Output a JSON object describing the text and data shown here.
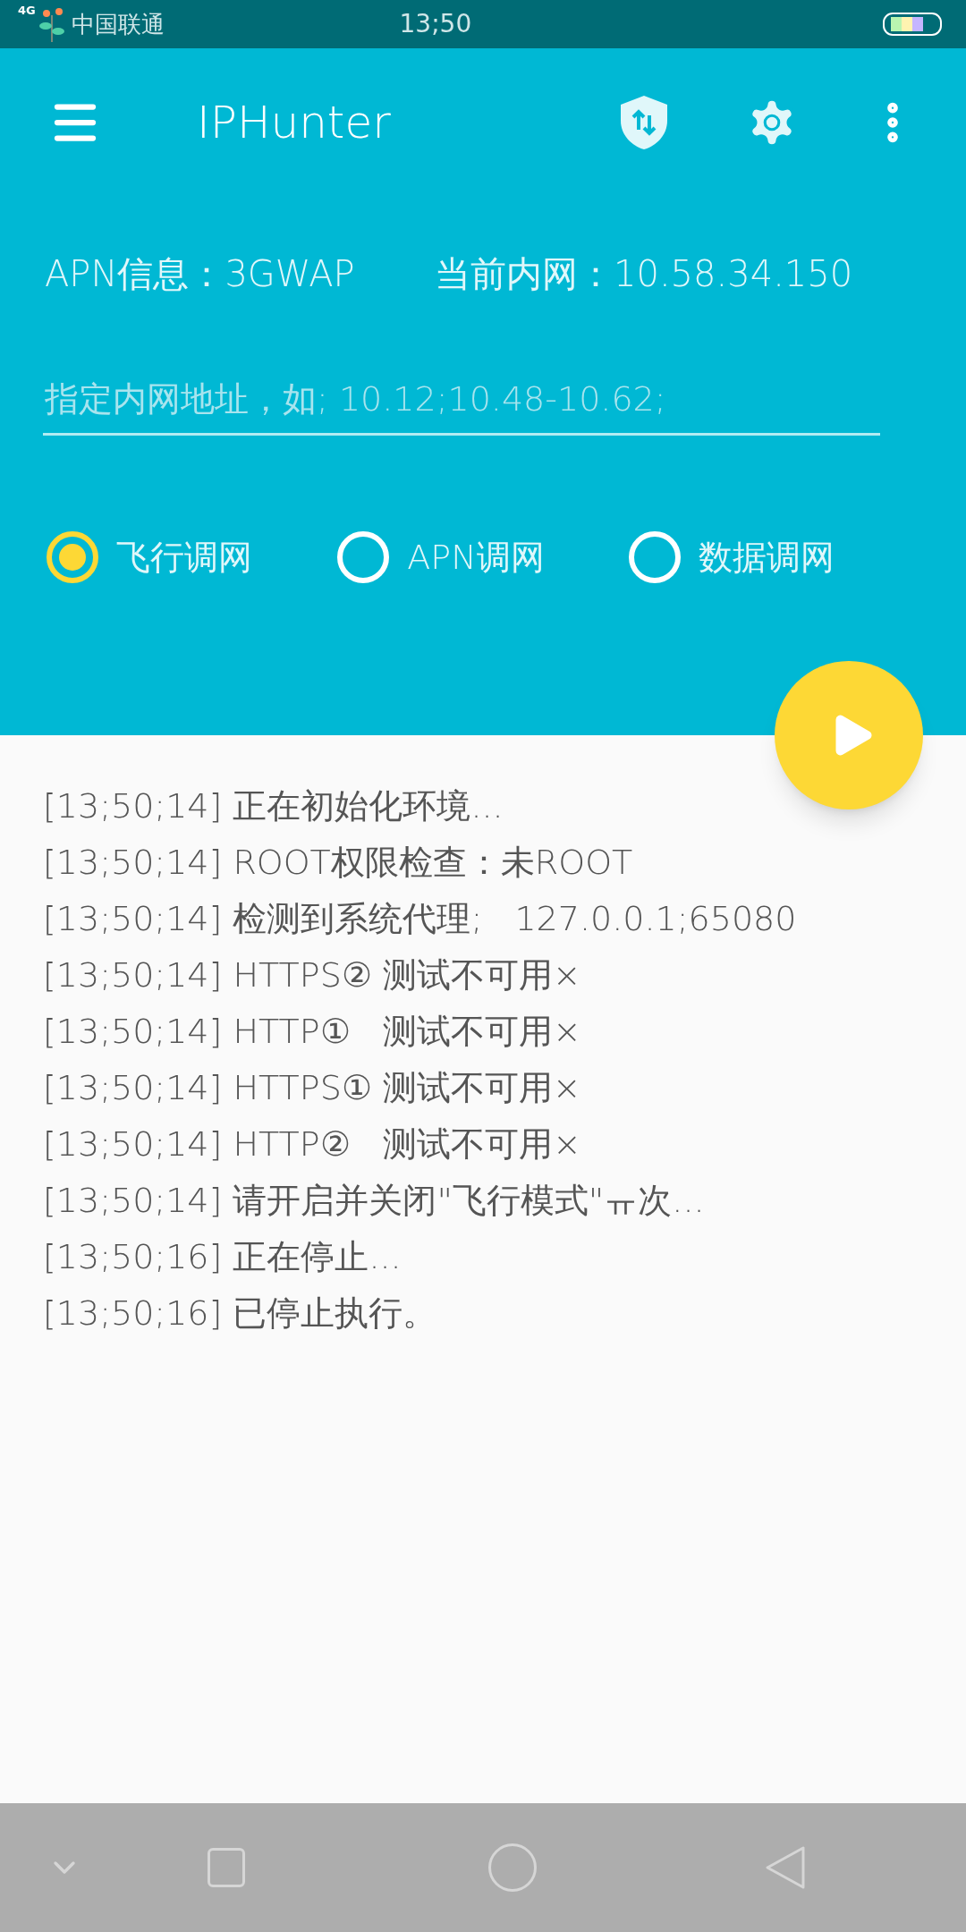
{
  "status_bar": {
    "network": "4G",
    "carrier": "中国联通",
    "time": "13;50"
  },
  "toolbar": {
    "title": "IPHunter"
  },
  "info": {
    "apn": "APN信息：3GWAP",
    "intranet": "当前内网：10.58.34.150"
  },
  "address_field": {
    "placeholder": "指定内网地址，如; 10.12;10.48-10.62;"
  },
  "modes": [
    {
      "label": "飞行调网",
      "selected": true
    },
    {
      "label": "APN调网",
      "selected": false
    },
    {
      "label": "数据调网",
      "selected": false
    }
  ],
  "log": [
    "[13;50;14] 正在初始化环境...",
    "[13;50;14] ROOT权限检查：未ROOT",
    "[13;50;14] 检测到系统代理;   127.0.0.1;65080",
    "[13;50;14] HTTPS② 测试不可用×",
    "[13;50;14] HTTP①   测试不可用×",
    "[13;50;14] HTTPS① 测试不可用×",
    "[13;50;14] HTTP②   测试不可用×",
    "[13;50;14] 请开启并关闭\"飞行模式\"ㅠ次...",
    "[13;50;16] 正在停止...",
    "[13;50;16] 已停止执行。"
  ]
}
